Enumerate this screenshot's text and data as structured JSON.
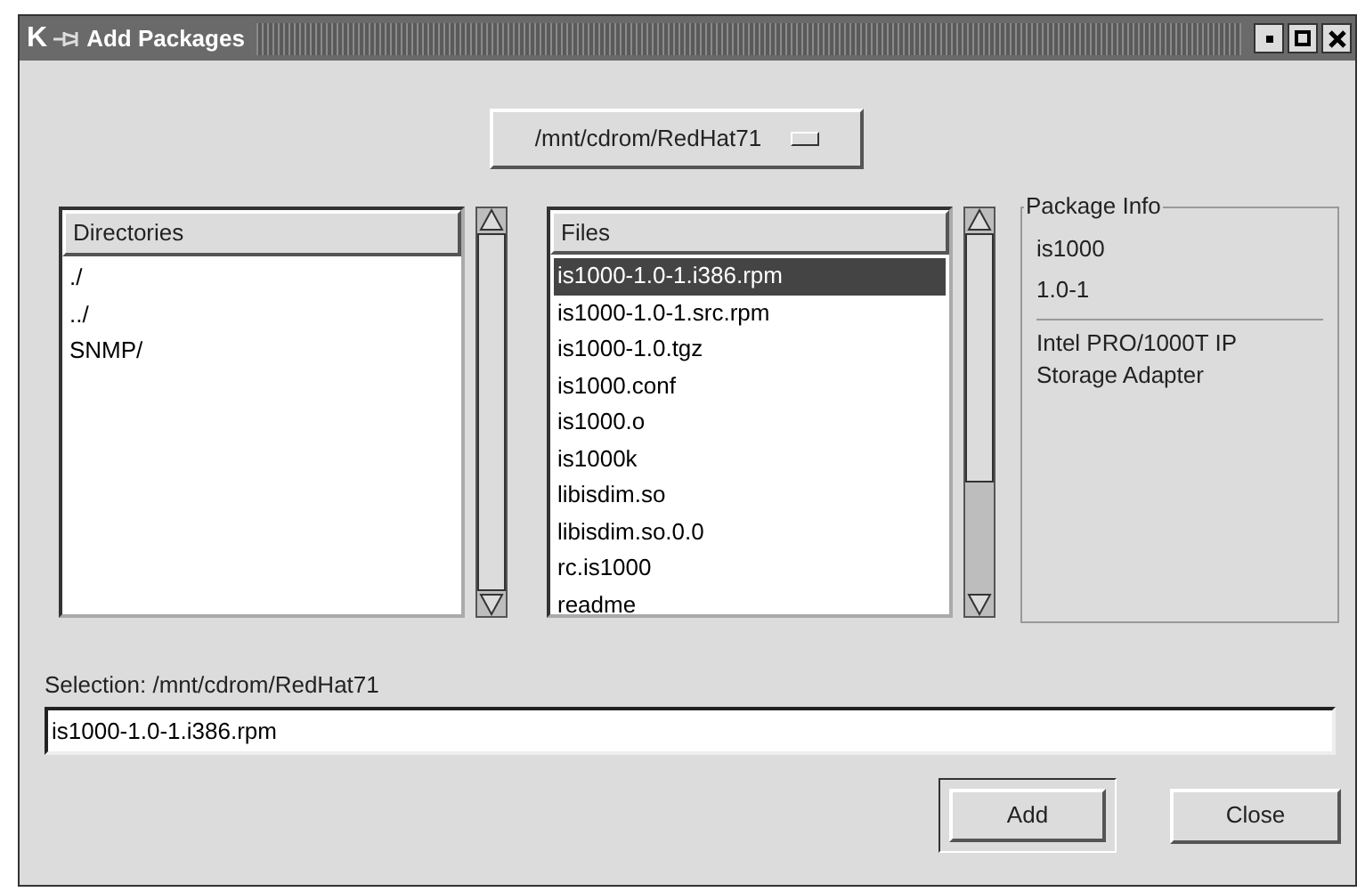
{
  "window": {
    "title": "Add Packages",
    "logo": "K"
  },
  "path_dropdown": {
    "value": "/mnt/cdrom/RedHat71"
  },
  "directories": {
    "header": "Directories",
    "items": [
      {
        "label": "./",
        "selected": false
      },
      {
        "label": "../",
        "selected": false
      },
      {
        "label": "SNMP/",
        "selected": false
      }
    ]
  },
  "files": {
    "header": "Files",
    "items": [
      {
        "label": "is1000-1.0-1.i386.rpm",
        "selected": true
      },
      {
        "label": "is1000-1.0-1.src.rpm",
        "selected": false
      },
      {
        "label": "is1000-1.0.tgz",
        "selected": false
      },
      {
        "label": "is1000.conf",
        "selected": false
      },
      {
        "label": "is1000.o",
        "selected": false
      },
      {
        "label": "is1000k",
        "selected": false
      },
      {
        "label": "libisdim.so",
        "selected": false
      },
      {
        "label": "libisdim.so.0.0",
        "selected": false
      },
      {
        "label": "rc.is1000",
        "selected": false
      },
      {
        "label": "readme",
        "selected": false
      }
    ]
  },
  "package_info": {
    "title": "Package Info",
    "name": "is1000",
    "version": "1.0-1",
    "description": "Intel PRO/1000T IP Storage Adapter"
  },
  "selection": {
    "label": "Selection: /mnt/cdrom/RedHat71",
    "value": "is1000-1.0-1.i386.rpm"
  },
  "buttons": [
    {
      "label": "Add",
      "default": true
    },
    {
      "label": "Close",
      "default": false
    }
  ]
}
